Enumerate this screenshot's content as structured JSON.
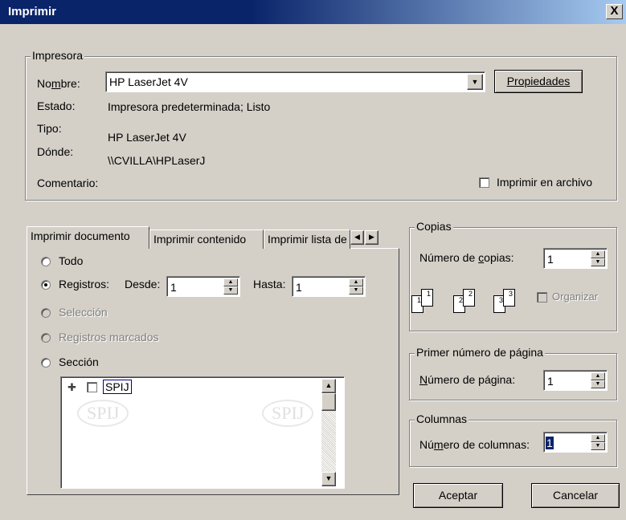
{
  "window": {
    "title": "Imprimir",
    "close_label": "X"
  },
  "printer": {
    "legend": "Impresora",
    "name_label": "Nombre:",
    "name_value": "HP LaserJet 4V",
    "properties_button": "Propiedades",
    "status_label": "Estado:",
    "status_value": "Impresora predeterminada; Listo",
    "type_label": "Tipo:",
    "type_value": "HP LaserJet 4V",
    "where_label": "Dónde:",
    "where_value": "\\\\CVILLA\\HPLaserJ",
    "comment_label": "Comentario:",
    "print_to_file": "Imprimir en archivo"
  },
  "tabs": [
    "Imprimir documento",
    "Imprimir contenido",
    "Imprimir lista de"
  ],
  "range": {
    "all": "Todo",
    "records": "Registros:",
    "from_label": "Desde:",
    "from_value": "1",
    "to_label": "Hasta:",
    "to_value": "1",
    "selection": "Selección",
    "marked": "Registros marcados",
    "section": "Sección",
    "tree_item": "SPIJ",
    "watermark": "SPIJ"
  },
  "copies": {
    "legend": "Copias",
    "count_label": "Número de copias:",
    "count_value": "1",
    "collate": "Organizar",
    "page_digits": [
      "1",
      "1",
      "2",
      "2",
      "3",
      "3"
    ]
  },
  "first_page": {
    "legend": "Primer número de página",
    "label": "Número de página:",
    "value": "1"
  },
  "columns": {
    "legend": "Columnas",
    "label": "Número de columnas:",
    "value": "1"
  },
  "buttons": {
    "ok": "Aceptar",
    "cancel": "Cancelar"
  }
}
